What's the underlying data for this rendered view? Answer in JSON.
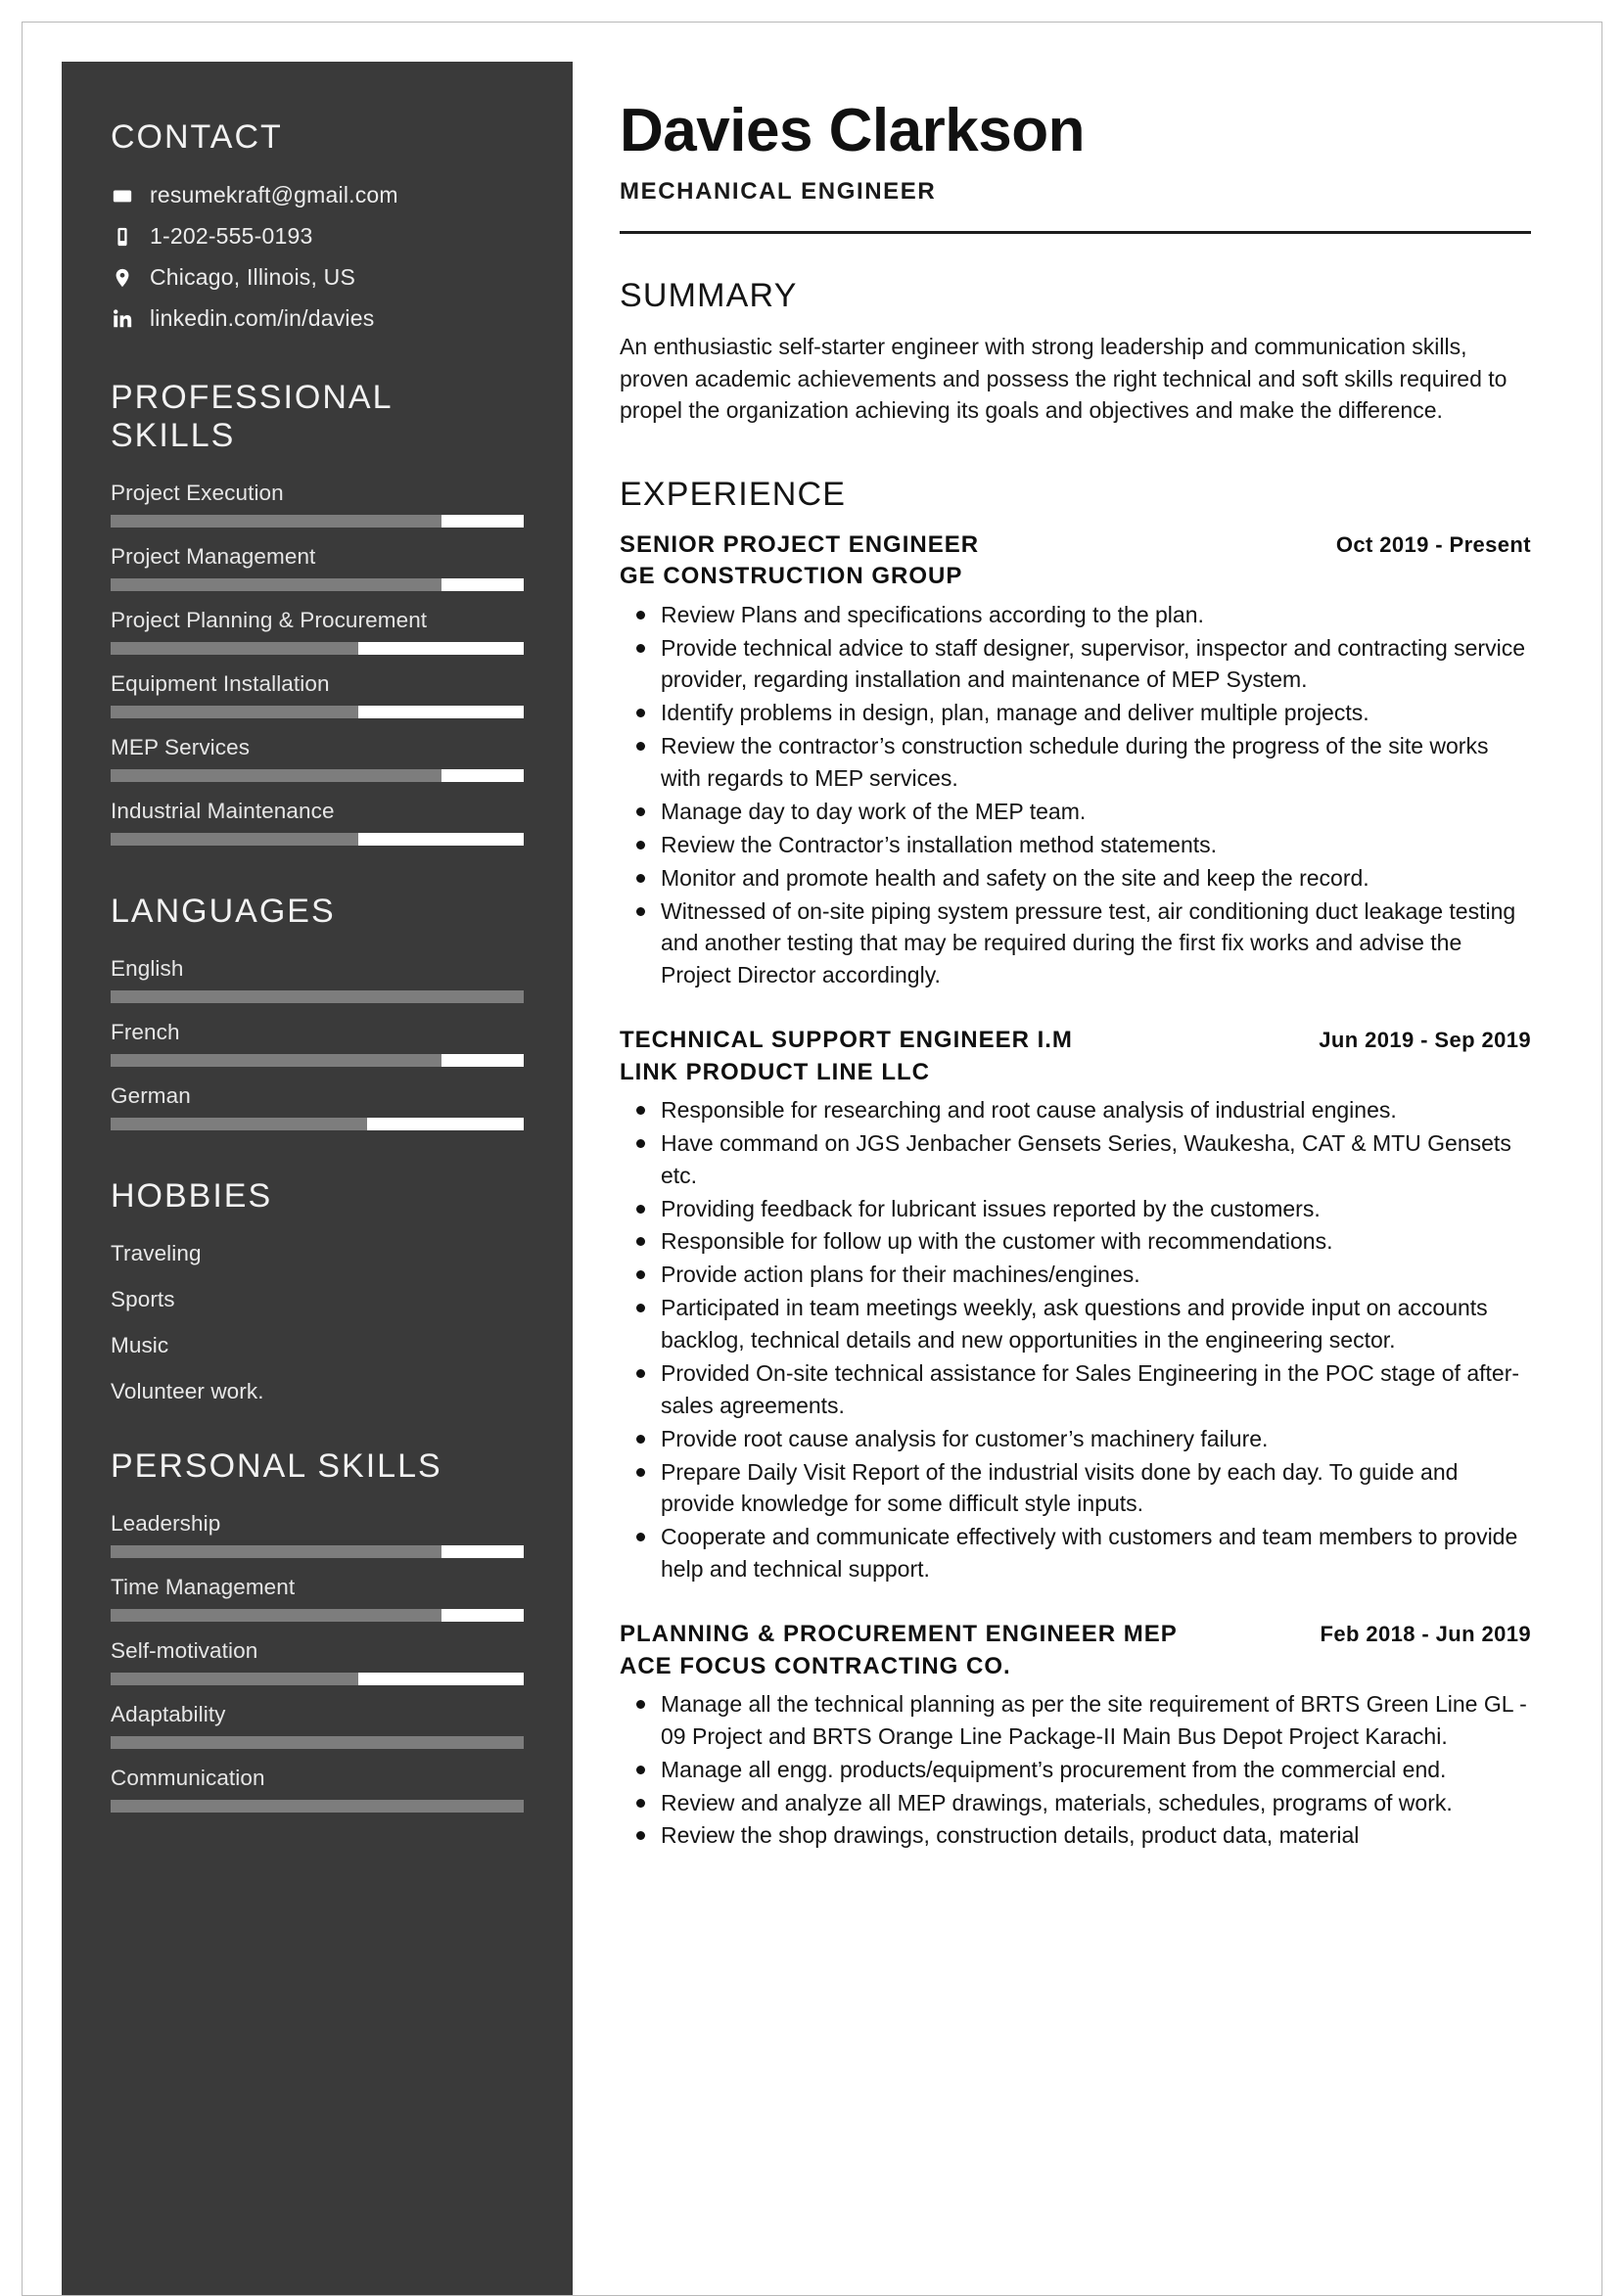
{
  "header": {
    "name": "Davies Clarkson",
    "title": "MECHANICAL ENGINEER"
  },
  "sidebar": {
    "contact": {
      "heading": "CONTACT",
      "items": [
        {
          "icon": "envelope-icon",
          "value": "resumekraft@gmail.com"
        },
        {
          "icon": "phone-icon",
          "value": "1-202-555-0193"
        },
        {
          "icon": "location-pin-icon",
          "value": "Chicago, Illinois, US"
        },
        {
          "icon": "linkedin-icon",
          "value": "linkedin.com/in/davies"
        }
      ]
    },
    "professional_skills": {
      "heading": "PROFESSIONAL SKILLS",
      "items": [
        {
          "label": "Project Execution",
          "level": 80
        },
        {
          "label": "Project Management",
          "level": 80
        },
        {
          "label": "Project Planning & Procurement",
          "level": 60
        },
        {
          "label": "Equipment Installation",
          "level": 60
        },
        {
          "label": "MEP Services",
          "level": 80
        },
        {
          "label": "Industrial Maintenance",
          "level": 60
        }
      ]
    },
    "languages": {
      "heading": "LANGUAGES",
      "items": [
        {
          "label": "English",
          "level": 100
        },
        {
          "label": "French",
          "level": 80
        },
        {
          "label": "German",
          "level": 62
        }
      ]
    },
    "hobbies": {
      "heading": "HOBBIES",
      "items": [
        {
          "label": "Traveling"
        },
        {
          "label": "Sports"
        },
        {
          "label": "Music"
        },
        {
          "label": "Volunteer work."
        }
      ]
    },
    "personal_skills": {
      "heading": "PERSONAL SKILLS",
      "items": [
        {
          "label": "Leadership",
          "level": 80
        },
        {
          "label": "Time Management",
          "level": 80
        },
        {
          "label": "Self-motivation",
          "level": 60
        },
        {
          "label": "Adaptability",
          "level": 100
        },
        {
          "label": "Communication",
          "level": 100
        }
      ]
    }
  },
  "main": {
    "summary": {
      "heading": "SUMMARY",
      "text": "An enthusiastic self-starter engineer with strong leadership and communication skills, proven academic achievements and possess the right technical and soft skills required to propel the organization achieving its goals and objectives and make the difference."
    },
    "experience": {
      "heading": "EXPERIENCE",
      "entries": [
        {
          "role": "SENIOR PROJECT ENGINEER",
          "company": "GE CONSTRUCTION GROUP",
          "dates": "Oct 2019 - Present",
          "bullets": [
            "Review Plans and specifications according to the plan.",
            "Provide technical advice to staff designer, supervisor, inspector and contracting service provider, regarding installation and maintenance of MEP System.",
            "Identify problems in design, plan, manage and deliver multiple projects.",
            "Review the contractor’s construction schedule during the progress of the site works with regards to MEP services.",
            "Manage day to day work of the MEP team.",
            "Review the Contractor’s installation method statements.",
            "Monitor and promote health and safety on the site and keep the record.",
            "Witnessed of on-site piping system pressure test, air conditioning duct leakage testing and another testing that may be required during the first fix works and advise the Project Director accordingly."
          ]
        },
        {
          "role": "TECHNICAL SUPPORT ENGINEER I.M",
          "company": "LINK PRODUCT LINE LLC",
          "dates": "Jun 2019 - Sep 2019",
          "bullets": [
            "Responsible for researching and root cause analysis of industrial engines.",
            "Have command on JGS Jenbacher Gensets Series, Waukesha, CAT & MTU Gensets etc.",
            "Providing feedback for lubricant issues reported by the customers.",
            "Responsible for follow up with the customer with recommendations.",
            "Provide action plans for their machines/engines.",
            "Participated in team meetings weekly, ask questions and provide input on accounts backlog, technical details and new opportunities in the engineering sector.",
            "Provided On-site technical assistance for Sales Engineering in the POC stage of after-sales agreements.",
            "Provide root cause analysis for customer’s machinery failure.",
            "Prepare Daily Visit Report of the industrial visits done by each day. To guide and provide knowledge for some difficult style inputs.",
            "Cooperate and communicate effectively with customers and team members to provide help and technical support."
          ]
        },
        {
          "role": "PLANNING & PROCUREMENT ENGINEER MEP",
          "company": "ACE FOCUS CONTRACTING CO.",
          "dates": "Feb 2018 - Jun 2019",
          "bullets": [
            "Manage all the technical planning as per the site requirement of BRTS Green Line GL - 09 Project and BRTS Orange Line Package-II Main Bus Depot Project Karachi.",
            "Manage all engg. products/equipment’s procurement from the commercial end.",
            "Review and analyze all MEP drawings, materials, schedules, programs of work.",
            "Review the shop drawings, construction details, product data, material"
          ]
        }
      ]
    }
  },
  "colors": {
    "sidebar_bg": "#3a3a3a",
    "bar_fill": "#7d7d7d",
    "bar_track": "#ffffff",
    "text_dark": "#111111"
  }
}
